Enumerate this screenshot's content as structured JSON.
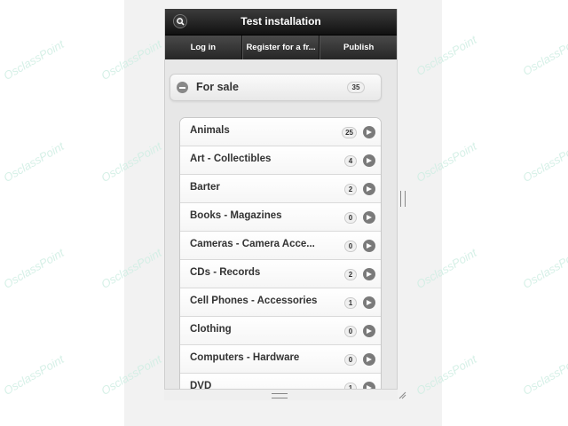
{
  "header": {
    "title": "Test installation",
    "search_icon": "search-icon"
  },
  "navbar": {
    "items": [
      {
        "label": "Log in"
      },
      {
        "label": "Register for a fr..."
      },
      {
        "label": "Publish"
      }
    ]
  },
  "forsale": {
    "label": "For sale",
    "count": "35",
    "icon": "minus-icon"
  },
  "categories": [
    {
      "label": "Animals",
      "count": "25"
    },
    {
      "label": "Art - Collectibles",
      "count": "4"
    },
    {
      "label": "Barter",
      "count": "2"
    },
    {
      "label": "Books - Magazines",
      "count": "0"
    },
    {
      "label": "Cameras - Camera Acce...",
      "count": "0"
    },
    {
      "label": "CDs - Records",
      "count": "2"
    },
    {
      "label": "Cell Phones - Accessories",
      "count": "1"
    },
    {
      "label": "Clothing",
      "count": "0"
    },
    {
      "label": "Computers - Hardware",
      "count": "0"
    },
    {
      "label": "DVD",
      "count": "1"
    }
  ],
  "watermark": {
    "text": "OsclassPoint"
  },
  "colors": {
    "header_dark": "#111111",
    "accent_watermark": "#cfeee3",
    "icon_gray": "#7a7a7a"
  }
}
